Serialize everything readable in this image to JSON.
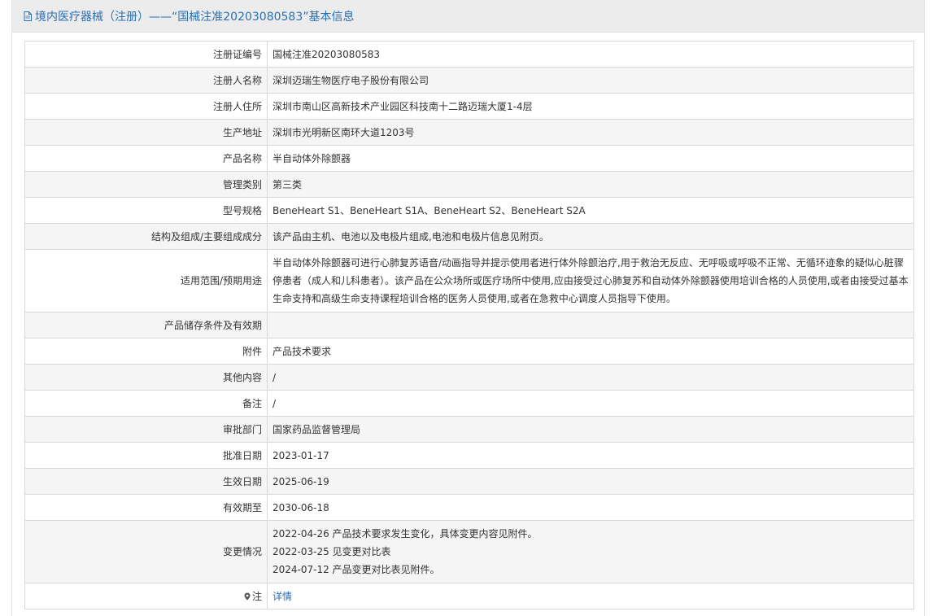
{
  "header": {
    "title": "境内医疗器械（注册）——“国械注准20203080583”基本信息"
  },
  "rows": {
    "reg_no": {
      "label": "注册证编号",
      "value": "国械注准20203080583"
    },
    "registrant": {
      "label": "注册人名称",
      "value": "深圳迈瑞生物医疗电子股份有限公司"
    },
    "registrant_addr": {
      "label": "注册人住所",
      "value": "深圳市南山区高新技术产业园区科技南十二路迈瑞大厦1-4层"
    },
    "production_addr": {
      "label": "生产地址",
      "value": "深圳市光明新区南环大道1203号"
    },
    "product_name": {
      "label": "产品名称",
      "value": "半自动体外除颤器"
    },
    "mgmt_class": {
      "label": "管理类别",
      "value": "第三类"
    },
    "model_spec": {
      "label": "型号规格",
      "value": "BeneHeart S1、BeneHeart S1A、BeneHeart S2、BeneHeart S2A"
    },
    "structure": {
      "label": "结构及组成/主要组成成分",
      "value": "该产品由主机、电池以及电极片组成,电池和电极片信息见附页。"
    },
    "scope": {
      "label": "适用范围/预期用途",
      "value": "半自动体外除颤器可进行心肺复苏语音/动画指导并提示使用者进行体外除颤治疗,用于救治无反应、无呼吸或呼吸不正常、无循环迹象的疑似心脏骤停患者（成人和儿科患者）。该产品在公众场所或医疗场所中使用,应由接受过心肺复苏和自动体外除颤器使用培训合格的人员使用,或者由接受过基本生命支持和高级生命支持课程培训合格的医务人员使用,或者在急救中心调度人员指导下使用。"
    },
    "storage": {
      "label": "产品储存条件及有效期",
      "value": ""
    },
    "attachment": {
      "label": "附件",
      "value": "产品技术要求"
    },
    "other": {
      "label": "其他内容",
      "value": "/"
    },
    "remark": {
      "label": "备注",
      "value": "/"
    },
    "approver": {
      "label": "审批部门",
      "value": "国家药品监督管理局"
    },
    "approval_date": {
      "label": "批准日期",
      "value": "2023-01-17"
    },
    "effective_date": {
      "label": "生效日期",
      "value": "2025-06-19"
    },
    "expiry_date": {
      "label": "有效期至",
      "value": "2030-06-18"
    },
    "changes": {
      "label": "变更情况",
      "items": [
        "2022-04-26 产品技术要求发生变化，具体变更内容见附件。",
        "2022-03-25 见变更对比表",
        "2024-07-12 产品变更对比表见附件。"
      ]
    },
    "note": {
      "label": "注",
      "value": "详情"
    }
  },
  "icons": {
    "header_icon": "document-icon",
    "note_icon": "pin-icon"
  },
  "colors": {
    "link": "#2a6fb3",
    "header_bg": "#ececec",
    "alt_row_bg": "#f5f5f5",
    "border": "#d8d8d8"
  }
}
